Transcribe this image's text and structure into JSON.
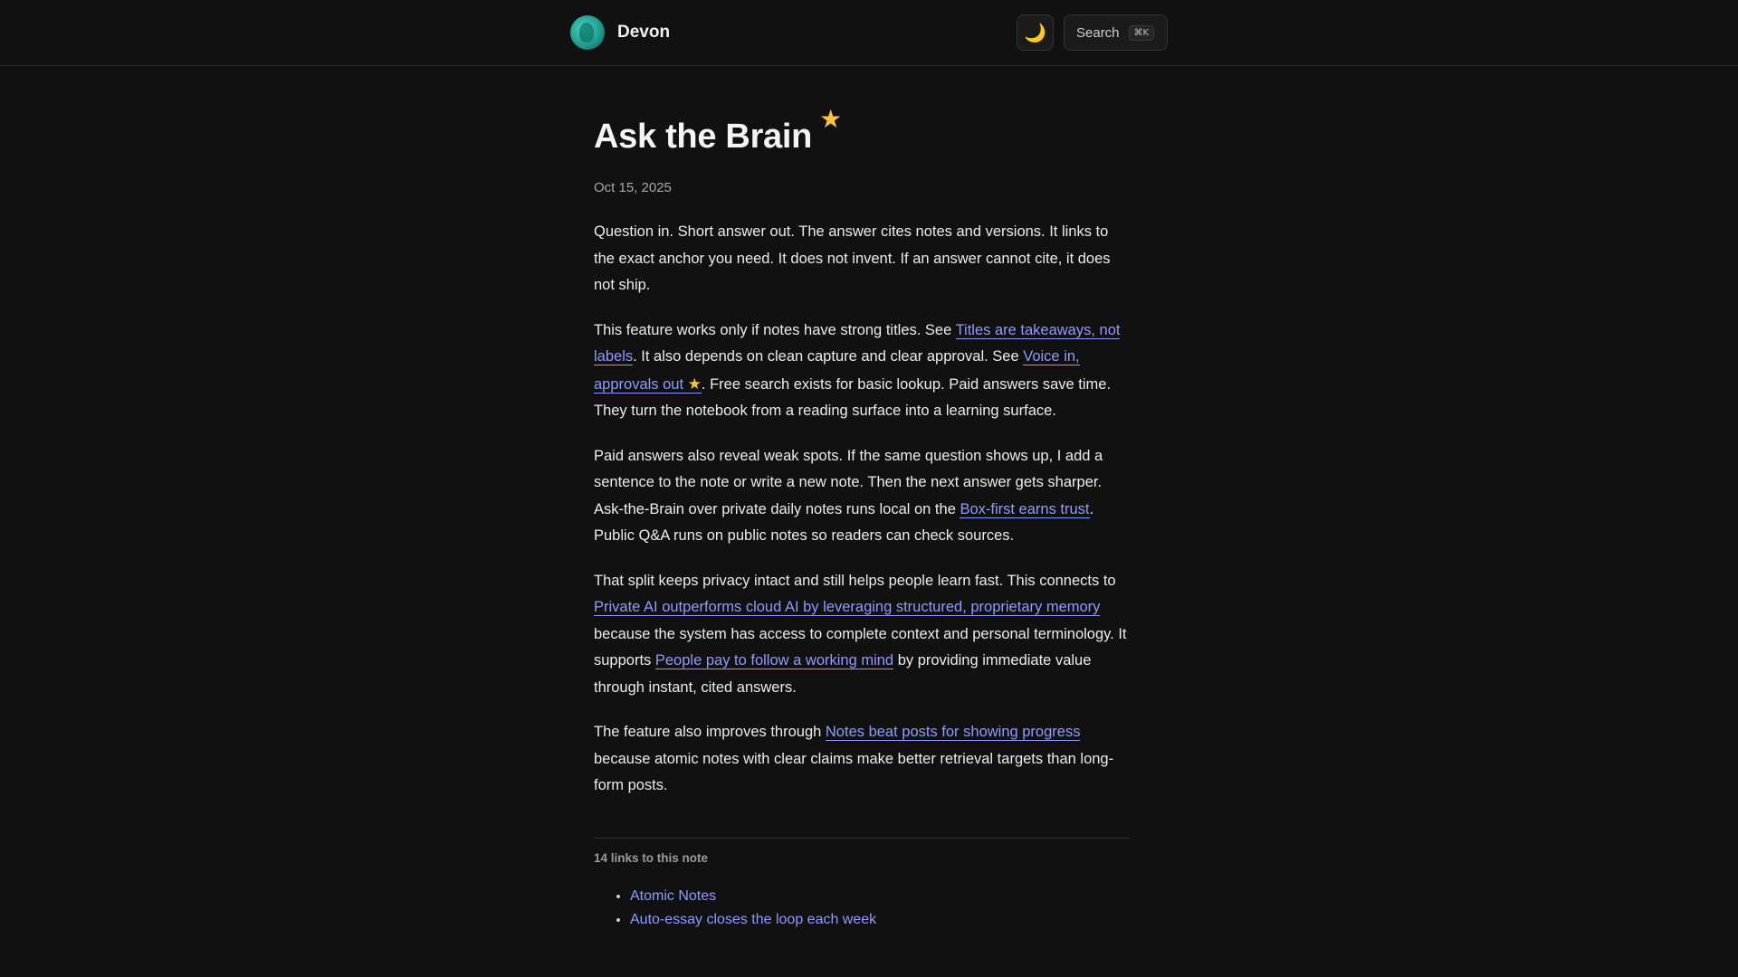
{
  "header": {
    "site_name": "Devon",
    "theme_icon": "moon-icon",
    "search_label": "Search",
    "search_shortcut": "⌘K"
  },
  "note": {
    "title": "Ask the Brain",
    "title_icon": "star-icon",
    "date": "Oct 15, 2025",
    "paragraphs": [
      [
        {
          "text": "Question in. Short answer out. The answer cites notes and versions. It links to the exact anchor you need. It does not invent. If an answer cannot cite, it does not ship."
        }
      ],
      [
        {
          "text": "This feature works only if notes have strong titles. See "
        },
        {
          "link": "Titles are takeaways, not labels"
        },
        {
          "text": ". It also depends on clean capture and clear approval. See "
        },
        {
          "link": "Voice in, approvals out",
          "star": true
        },
        {
          "text": ". Free search exists for basic lookup. Paid answers save time. They turn the notebook from a reading surface into a learning surface."
        }
      ],
      [
        {
          "text": "Paid answers also reveal weak spots. If the same question shows up, I add a sentence to the note or write a new note. Then the next answer gets sharper. Ask-the-Brain over private daily notes runs local on the "
        },
        {
          "link": "Box-first earns trust"
        },
        {
          "text": ". Public Q&A runs on public notes so readers can check sources."
        }
      ],
      [
        {
          "text": "That split keeps privacy intact and still helps people learn fast. This connects to "
        },
        {
          "link": "Private AI outperforms cloud AI by leveraging structured, proprietary memory"
        },
        {
          "text": " because the system has access to complete context and personal terminology. It supports "
        },
        {
          "link": "People pay to follow a working mind"
        },
        {
          "text": " by providing immediate value through instant, cited answers."
        }
      ],
      [
        {
          "text": "The feature also improves through "
        },
        {
          "link": "Notes beat posts for showing progress"
        },
        {
          "text": " because atomic notes with clear claims make better retrieval targets than long-form posts."
        }
      ]
    ]
  },
  "backlinks": {
    "heading": "14 links to this note",
    "items": [
      "Atomic Notes",
      "Auto-essay closes the loop each week"
    ]
  },
  "colors": {
    "background": "#111111",
    "text": "#ececec",
    "link": "#8f9bff",
    "star": "#f5c542"
  }
}
